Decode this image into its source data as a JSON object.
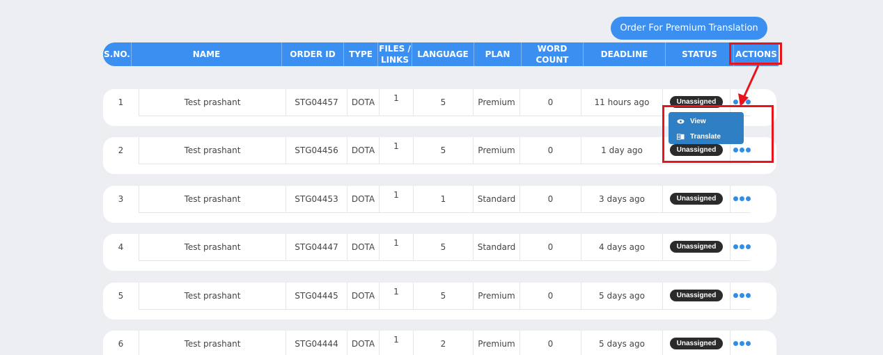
{
  "premium_button": {
    "label": "Order For Premium Translation"
  },
  "table": {
    "columns": [
      {
        "key": "sno",
        "label": "S.NO."
      },
      {
        "key": "name",
        "label": "NAME"
      },
      {
        "key": "order_id",
        "label": "ORDER ID"
      },
      {
        "key": "type",
        "label": "TYPE"
      },
      {
        "key": "files",
        "label": "FILES /\nLINKS"
      },
      {
        "key": "language",
        "label": "LANGUAGE"
      },
      {
        "key": "plan",
        "label": "PLAN"
      },
      {
        "key": "word_count",
        "label": "WORD COUNT"
      },
      {
        "key": "deadline",
        "label": "DEADLINE"
      },
      {
        "key": "status",
        "label": "STATUS"
      },
      {
        "key": "actions",
        "label": "ACTIONS"
      }
    ],
    "rows": [
      {
        "sno": "1",
        "name": "Test prashant",
        "order_id": "STG04457",
        "type": "DOTA",
        "files": "1",
        "language": "5",
        "plan": "Premium",
        "word_count": "0",
        "deadline": "11 hours ago",
        "status": "Unassigned"
      },
      {
        "sno": "2",
        "name": "Test prashant",
        "order_id": "STG04456",
        "type": "DOTA",
        "files": "1",
        "language": "5",
        "plan": "Premium",
        "word_count": "0",
        "deadline": "1 day ago",
        "status": "Unassigned"
      },
      {
        "sno": "3",
        "name": "Test prashant",
        "order_id": "STG04453",
        "type": "DOTA",
        "files": "1",
        "language": "1",
        "plan": "Standard",
        "word_count": "0",
        "deadline": "3 days ago",
        "status": "Unassigned"
      },
      {
        "sno": "4",
        "name": "Test prashant",
        "order_id": "STG04447",
        "type": "DOTA",
        "files": "1",
        "language": "5",
        "plan": "Standard",
        "word_count": "0",
        "deadline": "4 days ago",
        "status": "Unassigned"
      },
      {
        "sno": "5",
        "name": "Test prashant",
        "order_id": "STG04445",
        "type": "DOTA",
        "files": "1",
        "language": "5",
        "plan": "Premium",
        "word_count": "0",
        "deadline": "5 days ago",
        "status": "Unassigned"
      },
      {
        "sno": "6",
        "name": "Test prashant",
        "order_id": "STG04444",
        "type": "DOTA",
        "files": "1",
        "language": "2",
        "plan": "Premium",
        "word_count": "0",
        "deadline": "5 days ago",
        "status": "Unassigned"
      }
    ]
  },
  "actions_menu": {
    "items": [
      {
        "label": "View",
        "icon": "eye-icon"
      },
      {
        "label": "Translate",
        "icon": "translate-icon"
      }
    ]
  },
  "colors": {
    "header_blue": "#3b8ff0",
    "badge_dark": "#2b2b2b",
    "dots_blue": "#2f8ee8",
    "menu_blue": "#2f7fc4",
    "annotation_red": "#e8141c"
  }
}
